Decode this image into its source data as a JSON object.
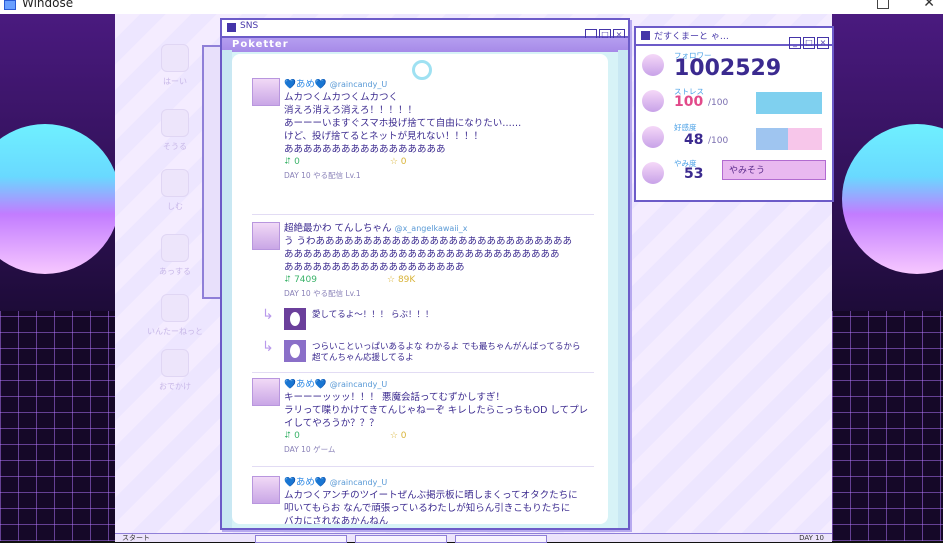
{
  "os_window": {
    "title": "Windose"
  },
  "desktop_icons": [
    "はーい",
    "そうる",
    "しむ",
    "あっする",
    "いんたーねっと",
    "おでかけ"
  ],
  "main_window": {
    "title": "SNS",
    "app_name": "Poketter",
    "controls": [
      "_",
      "□",
      "×"
    ]
  },
  "posts": [
    {
      "name": "💙あめ💙",
      "handle": "@raincandy_U",
      "lines": [
        "ムカつくムカつくムカつく",
        "消えろ消えろ消えろ！！！！！",
        "あーーーいますぐスマホ投げ捨てて自由になりたい……",
        "けど、投げ捨てるとネットが見れない！！！！",
        "あああああああああああああああああ"
      ],
      "retweets": "0",
      "likes": "0",
      "meta": "DAY 10 やる配信 Lv.1"
    },
    {
      "name": "超絶最かわ てんしちゃん",
      "handle": "@x_angelkawaii_x",
      "lines": [
        "う うわあああああああああああああああああああああああああああ",
        "あああああああああああああああああああああああああああああ",
        "あああああああああああああああああああ"
      ],
      "retweets": "7409",
      "likes": "89K",
      "meta": "DAY 10 やる配信 Lv.1"
    },
    {
      "name": "💙あめ💙",
      "handle": "@raincandy_U",
      "lines": [
        "キーーーッッッ！！！ 悪魔会話ってむずかしすぎ！",
        "ラリって喋りかけてきてんじゃねーぞ キレしたらこっちもOD してプレ",
        "イしてやろうか？？？"
      ],
      "retweets": "0",
      "likes": "0",
      "meta": "DAY 10 ゲーム"
    },
    {
      "name": "💙あめ💙",
      "handle": "@raincandy_U",
      "lines": [
        "ムカつくアンチのツイートぜんぶ掲示板に晒しまくってオタクたちに",
        "叩いてもらお なんで頑張っているわたしが知らん引きこもりたちに",
        "バカにされなあかんねん"
      ],
      "retweets": "0",
      "likes": "0",
      "meta": ""
    }
  ],
  "replies": [
    {
      "text": "愛してるよ〜！！！ らぶ！！！"
    },
    {
      "text": "つらいこといっぱいあるよな わかるよ でも最ちゃんがんばってるから超てんちゃん応援してるよ"
    }
  ],
  "stats_window": {
    "title": "だすくまーと ゃ…",
    "followers_label": "フォロワー",
    "followers": "1002529",
    "stress_label": "ストレス",
    "stress": "100",
    "stress_max": "/100",
    "affection_label": "好感度",
    "affection": "48",
    "affection_max": "/100",
    "yami_label": "やみ度",
    "yami": "53",
    "yami_status": "やみそう"
  },
  "stat_levels": {
    "stress": 1.0,
    "affection": 0.48
  },
  "colors": {
    "accent": "#6c5bc8",
    "stress_bar": "#7fd0ef",
    "affection_bar": "#9fc5f0"
  },
  "taskbar": {
    "start": "スタート",
    "clock": "DAY 10"
  }
}
